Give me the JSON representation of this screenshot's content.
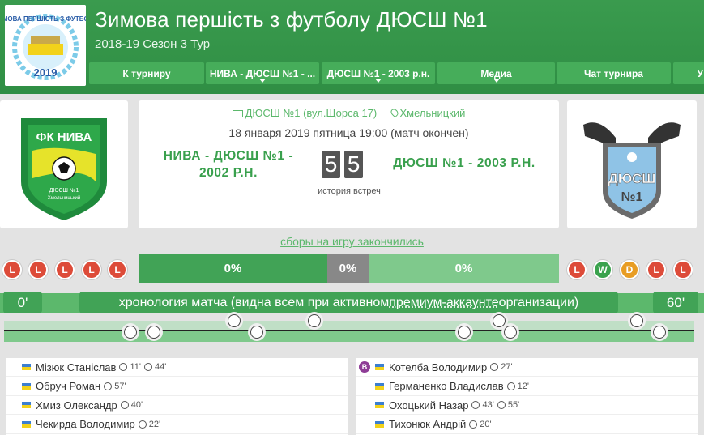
{
  "header": {
    "title": "Зимова першість з футболу ДЮСШ №1",
    "subtitle": "2018-19 Сезон 3 Тур",
    "logo_text": "ЗИМОВА ПЕРШІСТЬ З ФУТБОЛУ",
    "logo_year": "2019"
  },
  "nav": {
    "items": [
      {
        "label": "К турниру",
        "has_caret": false
      },
      {
        "label": "НИВА - ДЮСШ №1 - ...",
        "has_caret": true
      },
      {
        "label": "ДЮСШ №1 - 2003 р.н.",
        "has_caret": true
      },
      {
        "label": "Медиа",
        "has_caret": true
      },
      {
        "label": "Чат турнира",
        "has_caret": false
      },
      {
        "label": "У",
        "has_caret": false
      }
    ]
  },
  "match": {
    "venue": "ДЮСШ №1 (вул.Щорса 17)",
    "city": "Хмельницкий",
    "datetime": "18 января 2019 пятница 19:00 (матч окончен)",
    "home_name": "НИВА - ДЮСШ №1 -\n2002 Р.Н.",
    "home_name_1": "НИВА - ДЮСШ №1 -",
    "home_name_2": "2002 Р.Н.",
    "away_name": "ДЮСШ №1 - 2003 Р.Н.",
    "home_score": "5",
    "away_score": "5",
    "history_label": "история встреч",
    "home_logo_text": "ФК НИВА",
    "home_logo_sub": "ДЮСШ №1",
    "home_logo_city": "Хмельницький",
    "away_logo_text": "ДЮСШ",
    "away_logo_sub": "№1"
  },
  "collections_link": "сборы на игру закончились",
  "form": {
    "home": [
      "L",
      "L",
      "L",
      "L",
      "L"
    ],
    "away": [
      "L",
      "W",
      "D",
      "L",
      "L"
    ]
  },
  "probabilities": {
    "home": "0%",
    "draw": "0%",
    "away": "0%"
  },
  "chronology": {
    "start_label": "0'",
    "end_label": "60'",
    "label_before": "хронология матча (видна всем при активном ",
    "label_link": "премиум-аккаунте",
    "label_after": " организации)",
    "events": [
      {
        "minute": 11,
        "side": "home"
      },
      {
        "minute": 13,
        "side": "home"
      },
      {
        "minute": 20,
        "side": "away"
      },
      {
        "minute": 22,
        "side": "home"
      },
      {
        "minute": 27,
        "side": "away"
      },
      {
        "minute": 40,
        "side": "home"
      },
      {
        "minute": 44,
        "side": "home"
      },
      {
        "minute": 43,
        "side": "away"
      },
      {
        "minute": 55,
        "side": "away"
      },
      {
        "minute": 57,
        "side": "home"
      }
    ]
  },
  "scorers": {
    "home": [
      {
        "name": "Мізюк Станіслав",
        "minutes": [
          "11'",
          "44'"
        ]
      },
      {
        "name": "Обруч Роман",
        "minutes": [
          "57'"
        ]
      },
      {
        "name": "Хмиз Олександр",
        "minutes": [
          "40'"
        ]
      },
      {
        "name": "Чекирда Володимир",
        "minutes": [
          "22'"
        ]
      }
    ],
    "away": [
      {
        "name": "Котелба Володимир",
        "minutes": [
          "27'"
        ],
        "badge": "B"
      },
      {
        "name": "Германенко Владислав",
        "minutes": [
          "12'"
        ]
      },
      {
        "name": "Охоцький Назар",
        "minutes": [
          "43'",
          "55'"
        ]
      },
      {
        "name": "Тихонюк Андрій",
        "minutes": [
          "20'"
        ]
      }
    ]
  },
  "colors": {
    "brand_green": "#3a9b4e",
    "nav_green": "#46ad5a",
    "loss_red": "#dd4b39",
    "win_green": "#3aa24d",
    "draw_orange": "#e89d24",
    "draw_grey": "#888888",
    "away_prob_green": "#7fc98c"
  }
}
